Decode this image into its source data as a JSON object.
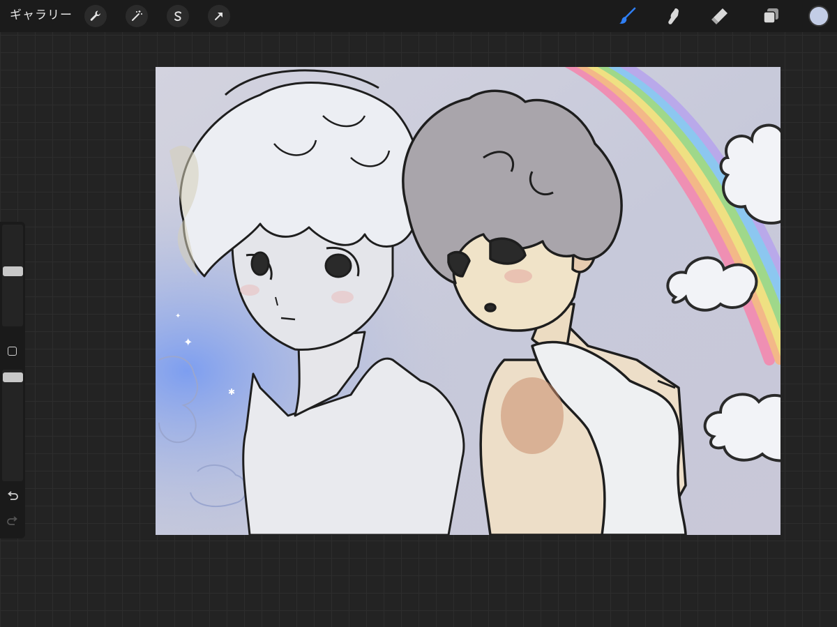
{
  "topbar": {
    "gallery_label": "ギャラリー",
    "actions_icon": "wrench-icon",
    "adjustments_icon": "magic-wand-icon",
    "selection_icon": "selection-s-icon",
    "transform_icon": "arrow-cursor-icon"
  },
  "tools": {
    "brush_icon": "brush-icon",
    "smudge_icon": "smudge-finger-icon",
    "eraser_icon": "eraser-icon",
    "layers_icon": "layers-icon",
    "active_tool": "brush",
    "active_color": "#c3cde6",
    "accent_color": "#2f7ff5"
  },
  "sidebar": {
    "brush_size": 0.55,
    "opacity": 1.0,
    "modify_icon": "square-modify-icon",
    "undo_icon": "undo-arrow-icon",
    "redo_icon": "redo-arrow-icon"
  },
  "canvas": {
    "artwork": "illustration-two-boys-rainbow-clouds"
  }
}
